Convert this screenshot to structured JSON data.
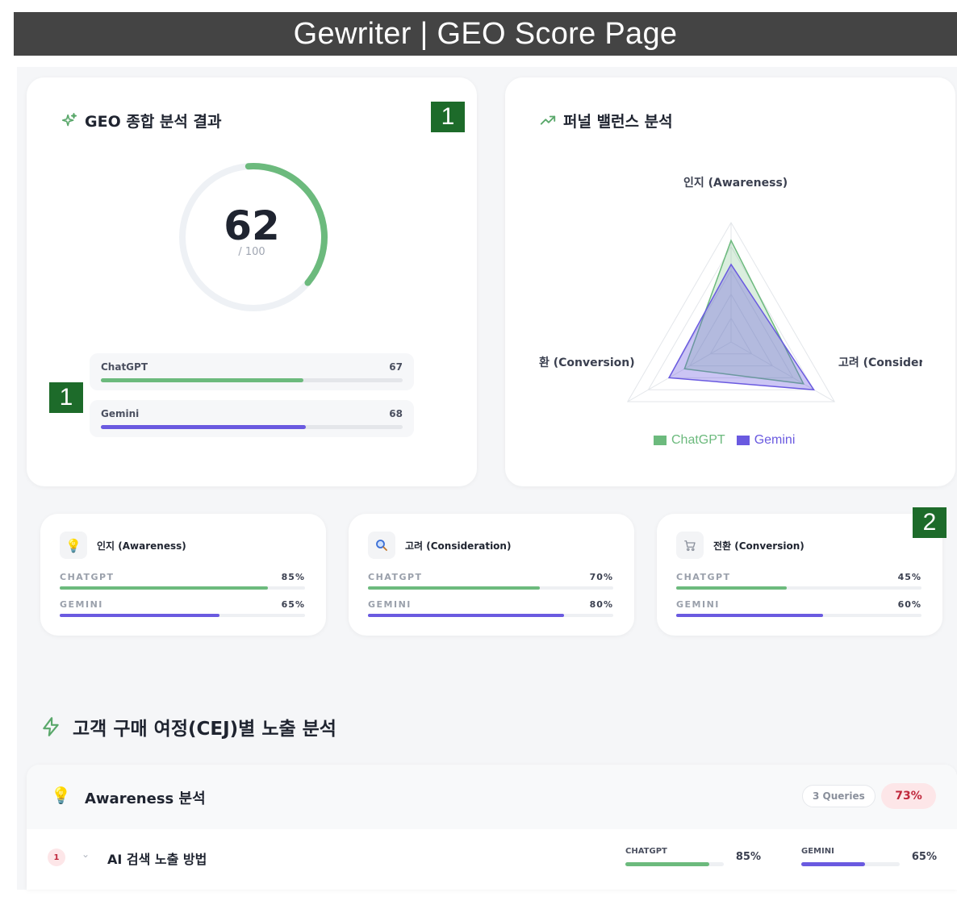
{
  "page_title": "Gewriter | GEO Score Page",
  "colors": {
    "chatgpt": "#6cba7d",
    "gemini": "#6a5ae0",
    "marker": "#1d6b2a"
  },
  "markers": {
    "score_card": "1",
    "model_rows": "1",
    "stage_cards": "2"
  },
  "score_card": {
    "title": "GEO 종합 분석 결과",
    "icon": "sparkles-icon",
    "score": "62",
    "score_value": 62,
    "max": "/ 100",
    "models": [
      {
        "name": "ChatGPT",
        "value": "67",
        "level": 0.67
      },
      {
        "name": "Gemini",
        "value": "68",
        "level": 0.68
      }
    ]
  },
  "funnel_card": {
    "title": "퍼널 밸런스 분석",
    "icon": "trend-up-icon",
    "axes": [
      "인지 (Awareness)",
      "고려 (Considera",
      "환 (Conversion)"
    ],
    "legend": [
      "ChatGPT",
      "Gemini"
    ],
    "series": [
      {
        "name": "ChatGPT",
        "values": [
          85,
          70,
          45
        ]
      },
      {
        "name": "Gemini",
        "values": [
          65,
          80,
          60
        ]
      }
    ]
  },
  "stages": [
    {
      "name": "인지 (Awareness)",
      "icon": "lightbulb-icon",
      "chatgpt_label": "CHATGPT",
      "chatgpt": "85%",
      "chatgpt_level": 0.85,
      "gemini_label": "GEMINI",
      "gemini": "65%",
      "gemini_level": 0.65
    },
    {
      "name": "고려 (Consideration)",
      "icon": "magnifier-icon",
      "chatgpt_label": "CHATGPT",
      "chatgpt": "70%",
      "chatgpt_level": 0.7,
      "gemini_label": "GEMINI",
      "gemini": "80%",
      "gemini_level": 0.8
    },
    {
      "name": "전환 (Conversion)",
      "icon": "cart-icon",
      "chatgpt_label": "CHATGPT",
      "chatgpt": "45%",
      "chatgpt_level": 0.45,
      "gemini_label": "GEMINI",
      "gemini": "60%",
      "gemini_level": 0.6
    }
  ],
  "cej_section": {
    "title": "고객 구매 여정(CEJ)별 노출 분석",
    "icon": "lightning-icon",
    "panel": {
      "title": "Awareness 분석",
      "icon": "lightbulb-icon",
      "queries_badge": "3 Queries",
      "percent_badge": "73%",
      "rows": [
        {
          "num": "1",
          "text": "AI 검색 노출 방법",
          "chatgpt_label": "CHATGPT",
          "chatgpt": "85%",
          "chatgpt_level": 0.85,
          "gemini_label": "GEMINI",
          "gemini": "65%",
          "gemini_level": 0.65
        }
      ]
    }
  }
}
